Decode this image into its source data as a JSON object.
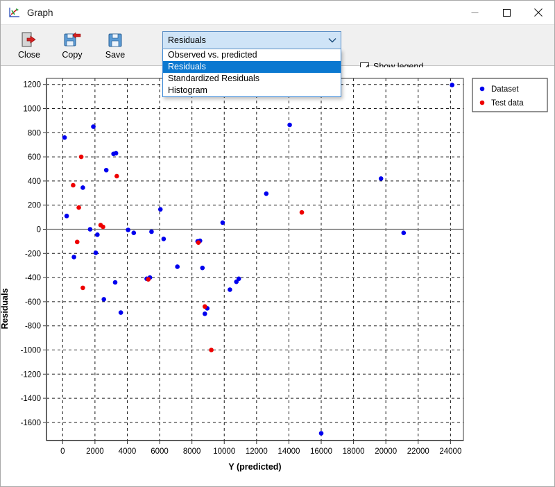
{
  "window": {
    "title": "Graph",
    "icon": "graph-icon",
    "controls": {
      "minimize": "minimize-icon",
      "maximize": "maximize-icon",
      "close": "close-icon"
    }
  },
  "toolbar": {
    "buttons": [
      {
        "label": "Close",
        "icon": "close-door-icon"
      },
      {
        "label": "Copy",
        "icon": "copy-disk-icon"
      },
      {
        "label": "Save",
        "icon": "save-disk-icon"
      }
    ],
    "dropdown": {
      "selected": "Residuals",
      "expanded": true,
      "chevron": "chevron-down-icon",
      "options": [
        "Observed vs. predicted",
        "Residuals",
        "Standardized Residuals",
        "Histogram"
      ]
    },
    "checkbox": {
      "label": "Show legend",
      "checked": true,
      "mark": "check-icon"
    }
  },
  "colors": {
    "dataset": "#0000ee",
    "test": "#ee0000",
    "grid": "#1a1a1a",
    "axis": "#555555",
    "highlight": "#0b78d0",
    "combo_bg": "#cfe4f7"
  },
  "chart_data": {
    "type": "scatter",
    "title": "",
    "xlabel": "Y (predicted)",
    "ylabel": "Residuals",
    "xlim": [
      -1000,
      24800
    ],
    "ylim": [
      -1750,
      1250
    ],
    "xticks": [
      0,
      2000,
      4000,
      6000,
      8000,
      10000,
      12000,
      14000,
      16000,
      18000,
      20000,
      22000,
      24000
    ],
    "yticks": [
      1200,
      1000,
      800,
      600,
      400,
      200,
      0,
      -200,
      -400,
      -600,
      -800,
      -1000,
      -1200,
      -1400,
      -1600
    ],
    "grid": true,
    "zero_line": 0,
    "legend": {
      "visible": true,
      "position": "outside-top-right",
      "entries": [
        {
          "name": "Dataset",
          "color": "#0000ee"
        },
        {
          "name": "Test data",
          "color": "#ee0000"
        }
      ]
    },
    "series": [
      {
        "name": "Dataset",
        "color": "#0000ee",
        "points": [
          [
            120,
            760
          ],
          [
            250,
            110
          ],
          [
            700,
            -230
          ],
          [
            1250,
            345
          ],
          [
            1700,
            0
          ],
          [
            1900,
            850
          ],
          [
            2050,
            -195
          ],
          [
            2150,
            -45
          ],
          [
            2550,
            -580
          ],
          [
            2700,
            490
          ],
          [
            3150,
            625
          ],
          [
            3300,
            630
          ],
          [
            3250,
            -440
          ],
          [
            3600,
            -690
          ],
          [
            4050,
            -5
          ],
          [
            4400,
            -30
          ],
          [
            5200,
            -410
          ],
          [
            5400,
            -400
          ],
          [
            5500,
            -20
          ],
          [
            6050,
            165
          ],
          [
            6250,
            -80
          ],
          [
            7100,
            -310
          ],
          [
            8350,
            -100
          ],
          [
            8500,
            -95
          ],
          [
            8650,
            -320
          ],
          [
            8800,
            -700
          ],
          [
            8950,
            -655
          ],
          [
            9900,
            55
          ],
          [
            10350,
            -500
          ],
          [
            10750,
            -435
          ],
          [
            10900,
            -410
          ],
          [
            12600,
            295
          ],
          [
            14050,
            865
          ],
          [
            16000,
            -1690
          ],
          [
            19700,
            420
          ],
          [
            21100,
            -30
          ],
          [
            24100,
            1195
          ]
        ]
      },
      {
        "name": "Test data",
        "color": "#ee0000",
        "points": [
          [
            650,
            365
          ],
          [
            900,
            -105
          ],
          [
            1000,
            180
          ],
          [
            1150,
            600
          ],
          [
            1250,
            -485
          ],
          [
            2350,
            35
          ],
          [
            2500,
            20
          ],
          [
            3350,
            440
          ],
          [
            5300,
            -415
          ],
          [
            8400,
            -110
          ],
          [
            8800,
            -640
          ],
          [
            9200,
            -1000
          ],
          [
            14800,
            140
          ]
        ]
      }
    ]
  }
}
